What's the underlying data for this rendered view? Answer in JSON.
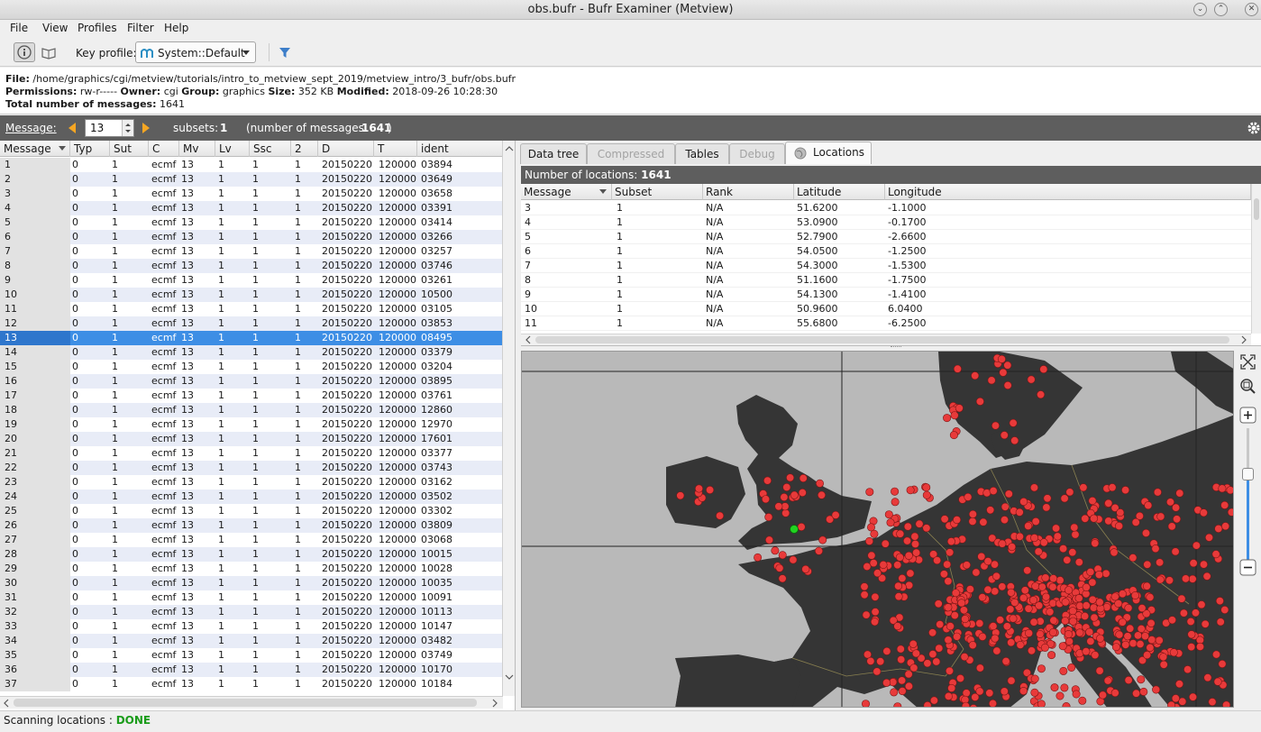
{
  "window": {
    "title": "obs.bufr - Bufr Examiner (Metview)"
  },
  "menu": [
    "File",
    "View",
    "Profiles",
    "Filter",
    "Help"
  ],
  "toolbar": {
    "key_profile_label": "Key profile:",
    "key_profile_value": "System::Default"
  },
  "file_info": {
    "file_label": "File:",
    "file_path": "/home/graphics/cgi/metview/tutorials/intro_to_metview_sept_2019/metview_intro/3_bufr/obs.bufr",
    "permissions_label": "Permissions:",
    "permissions": "rw-r-----",
    "owner_label": "Owner:",
    "owner": "cgi",
    "group_label": "Group:",
    "group": "graphics",
    "size_label": "Size:",
    "size": "352 KB",
    "modified_label": "Modified:",
    "modified": "2018-09-26 10:28:30",
    "total_label": "Total number of messages:",
    "total": "1641"
  },
  "message_bar": {
    "message_label": "Message:",
    "message_value": "13",
    "subsets_label": "subsets:",
    "subsets": "1",
    "count_prefix": "(number of messages:",
    "count": "1641",
    "count_suffix": ")"
  },
  "left_table": {
    "columns": [
      "Message",
      "Typ",
      "Sut",
      "C",
      "Mv",
      "Lv",
      "Ssc",
      "2",
      "D",
      "T",
      "ident"
    ],
    "selected_row": 13,
    "rows": [
      [
        "1",
        "0",
        "1",
        "ecmf",
        "13",
        "1",
        "1",
        "1",
        "20150220",
        "120000",
        "03894"
      ],
      [
        "2",
        "0",
        "1",
        "ecmf",
        "13",
        "1",
        "1",
        "1",
        "20150220",
        "120000",
        "03649"
      ],
      [
        "3",
        "0",
        "1",
        "ecmf",
        "13",
        "1",
        "1",
        "1",
        "20150220",
        "120000",
        "03658"
      ],
      [
        "4",
        "0",
        "1",
        "ecmf",
        "13",
        "1",
        "1",
        "1",
        "20150220",
        "120000",
        "03391"
      ],
      [
        "5",
        "0",
        "1",
        "ecmf",
        "13",
        "1",
        "1",
        "1",
        "20150220",
        "120000",
        "03414"
      ],
      [
        "6",
        "0",
        "1",
        "ecmf",
        "13",
        "1",
        "1",
        "1",
        "20150220",
        "120000",
        "03266"
      ],
      [
        "7",
        "0",
        "1",
        "ecmf",
        "13",
        "1",
        "1",
        "1",
        "20150220",
        "120000",
        "03257"
      ],
      [
        "8",
        "0",
        "1",
        "ecmf",
        "13",
        "1",
        "1",
        "1",
        "20150220",
        "120000",
        "03746"
      ],
      [
        "9",
        "0",
        "1",
        "ecmf",
        "13",
        "1",
        "1",
        "1",
        "20150220",
        "120000",
        "03261"
      ],
      [
        "10",
        "0",
        "1",
        "ecmf",
        "13",
        "1",
        "1",
        "1",
        "20150220",
        "120000",
        "10500"
      ],
      [
        "11",
        "0",
        "1",
        "ecmf",
        "13",
        "1",
        "1",
        "1",
        "20150220",
        "120000",
        "03105"
      ],
      [
        "12",
        "0",
        "1",
        "ecmf",
        "13",
        "1",
        "1",
        "1",
        "20150220",
        "120000",
        "03853"
      ],
      [
        "13",
        "0",
        "1",
        "ecmf",
        "13",
        "1",
        "1",
        "1",
        "20150220",
        "120000",
        "08495"
      ],
      [
        "14",
        "0",
        "1",
        "ecmf",
        "13",
        "1",
        "1",
        "1",
        "20150220",
        "120000",
        "03379"
      ],
      [
        "15",
        "0",
        "1",
        "ecmf",
        "13",
        "1",
        "1",
        "1",
        "20150220",
        "120000",
        "03204"
      ],
      [
        "16",
        "0",
        "1",
        "ecmf",
        "13",
        "1",
        "1",
        "1",
        "20150220",
        "120000",
        "03895"
      ],
      [
        "17",
        "0",
        "1",
        "ecmf",
        "13",
        "1",
        "1",
        "1",
        "20150220",
        "120000",
        "03761"
      ],
      [
        "18",
        "0",
        "1",
        "ecmf",
        "13",
        "1",
        "1",
        "1",
        "20150220",
        "120000",
        "12860"
      ],
      [
        "19",
        "0",
        "1",
        "ecmf",
        "13",
        "1",
        "1",
        "1",
        "20150220",
        "120000",
        "12970"
      ],
      [
        "20",
        "0",
        "1",
        "ecmf",
        "13",
        "1",
        "1",
        "1",
        "20150220",
        "120000",
        "17601"
      ],
      [
        "21",
        "0",
        "1",
        "ecmf",
        "13",
        "1",
        "1",
        "1",
        "20150220",
        "120000",
        "03377"
      ],
      [
        "22",
        "0",
        "1",
        "ecmf",
        "13",
        "1",
        "1",
        "1",
        "20150220",
        "120000",
        "03743"
      ],
      [
        "23",
        "0",
        "1",
        "ecmf",
        "13",
        "1",
        "1",
        "1",
        "20150220",
        "120000",
        "03162"
      ],
      [
        "24",
        "0",
        "1",
        "ecmf",
        "13",
        "1",
        "1",
        "1",
        "20150220",
        "120000",
        "03502"
      ],
      [
        "25",
        "0",
        "1",
        "ecmf",
        "13",
        "1",
        "1",
        "1",
        "20150220",
        "120000",
        "03302"
      ],
      [
        "26",
        "0",
        "1",
        "ecmf",
        "13",
        "1",
        "1",
        "1",
        "20150220",
        "120000",
        "03809"
      ],
      [
        "27",
        "0",
        "1",
        "ecmf",
        "13",
        "1",
        "1",
        "1",
        "20150220",
        "120000",
        "03068"
      ],
      [
        "28",
        "0",
        "1",
        "ecmf",
        "13",
        "1",
        "1",
        "1",
        "20150220",
        "120000",
        "10015"
      ],
      [
        "29",
        "0",
        "1",
        "ecmf",
        "13",
        "1",
        "1",
        "1",
        "20150220",
        "120000",
        "10028"
      ],
      [
        "30",
        "0",
        "1",
        "ecmf",
        "13",
        "1",
        "1",
        "1",
        "20150220",
        "120000",
        "10035"
      ],
      [
        "31",
        "0",
        "1",
        "ecmf",
        "13",
        "1",
        "1",
        "1",
        "20150220",
        "120000",
        "10091"
      ],
      [
        "32",
        "0",
        "1",
        "ecmf",
        "13",
        "1",
        "1",
        "1",
        "20150220",
        "120000",
        "10113"
      ],
      [
        "33",
        "0",
        "1",
        "ecmf",
        "13",
        "1",
        "1",
        "1",
        "20150220",
        "120000",
        "10147"
      ],
      [
        "34",
        "0",
        "1",
        "ecmf",
        "13",
        "1",
        "1",
        "1",
        "20150220",
        "120000",
        "03482"
      ],
      [
        "35",
        "0",
        "1",
        "ecmf",
        "13",
        "1",
        "1",
        "1",
        "20150220",
        "120000",
        "03749"
      ],
      [
        "36",
        "0",
        "1",
        "ecmf",
        "13",
        "1",
        "1",
        "1",
        "20150220",
        "120000",
        "10170"
      ],
      [
        "37",
        "0",
        "1",
        "ecmf",
        "13",
        "1",
        "1",
        "1",
        "20150220",
        "120000",
        "10184"
      ]
    ]
  },
  "tabs": [
    {
      "label": "Data tree",
      "state": "normal"
    },
    {
      "label": "Compressed",
      "state": "disabled"
    },
    {
      "label": "Tables",
      "state": "normal"
    },
    {
      "label": "Debug",
      "state": "disabled"
    },
    {
      "label": "Locations",
      "state": "active"
    }
  ],
  "locations": {
    "count_label": "Number of locations:",
    "count": "1641",
    "columns": [
      "Message",
      "Subset",
      "Rank",
      "Latitude",
      "Longitude"
    ],
    "rows": [
      [
        "3",
        "1",
        "N/A",
        "51.6200",
        "-1.1000"
      ],
      [
        "4",
        "1",
        "N/A",
        "53.0900",
        "-0.1700"
      ],
      [
        "5",
        "1",
        "N/A",
        "52.7900",
        "-2.6600"
      ],
      [
        "6",
        "1",
        "N/A",
        "54.0500",
        "-1.2500"
      ],
      [
        "7",
        "1",
        "N/A",
        "54.3000",
        "-1.5300"
      ],
      [
        "8",
        "1",
        "N/A",
        "51.1600",
        "-1.7500"
      ],
      [
        "9",
        "1",
        "N/A",
        "54.1300",
        "-1.4100"
      ],
      [
        "10",
        "1",
        "N/A",
        "50.9600",
        "6.0400"
      ],
      [
        "11",
        "1",
        "N/A",
        "55.6800",
        "-6.2500"
      ]
    ]
  },
  "map": {
    "land_color": "#353535",
    "sea_color": "#b9b9b9",
    "station_color": "#e83a3a",
    "selected_color": "#21d321"
  },
  "status": {
    "prefix": "Scanning locations :",
    "state": "DONE"
  }
}
